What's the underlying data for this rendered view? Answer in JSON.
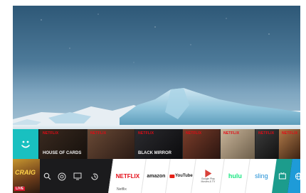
{
  "rail": {
    "thumbnails": [
      {
        "brand": "NETFLIX",
        "title": "House of Cards"
      },
      {
        "brand": "NETFLIX",
        "title": ""
      },
      {
        "brand": "NETFLIX",
        "title": "Black Mirror"
      },
      {
        "brand": "NETFLIX",
        "title": ""
      },
      {
        "brand": "NETFLIX",
        "title": ""
      },
      {
        "brand": "NETFLIX",
        "title": ""
      },
      {
        "brand": "NETFLIX",
        "title": ""
      }
    ]
  },
  "launcher": {
    "live_tile": {
      "title": "CRAIG",
      "badge": "LIVE"
    },
    "apps": [
      {
        "label": "NETFLIX",
        "color": "#e50914"
      },
      {
        "label": "amazon",
        "color": "#222222"
      },
      {
        "label": "YouTube",
        "color": "#e62117"
      },
      {
        "label": "Google Play Movies & TV",
        "color": "#d9413a"
      },
      {
        "label": "hulu",
        "color": "#1ce783"
      },
      {
        "label": "sling",
        "color": "#1e8fd6"
      }
    ],
    "focused_app_name": "Netflix"
  },
  "colors": {
    "accent_teal": "#19c0c0",
    "browser_blue": "#1e9bd8"
  }
}
